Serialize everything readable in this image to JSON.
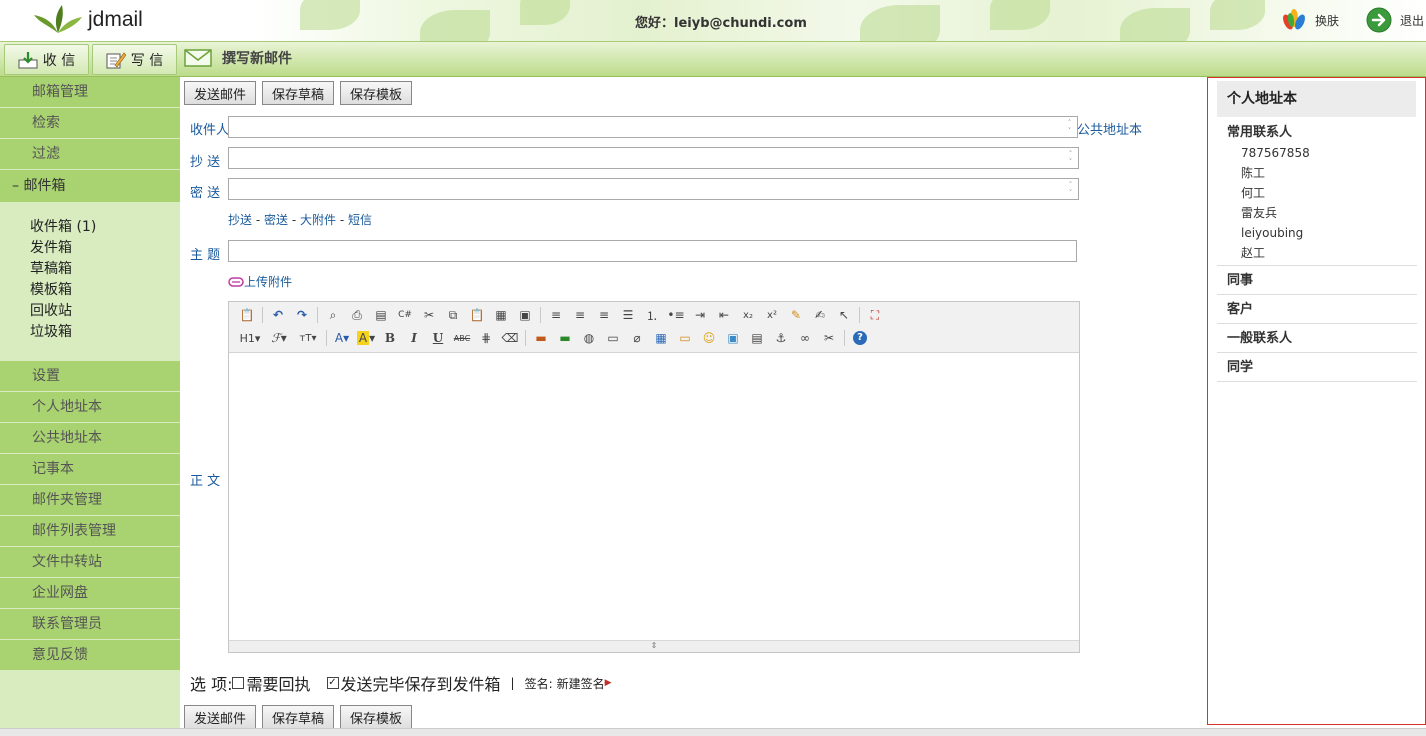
{
  "header": {
    "logo_text": "jdmail",
    "greeting": "您好：leiyb@chundi.com",
    "skin_label": "换肤",
    "logout_label": "退出"
  },
  "toolbar": {
    "receive_label": "收 信",
    "write_label": "写 信",
    "compose_title": "撰写新邮件"
  },
  "sidebar": {
    "top_items": [
      "邮箱管理",
      "检索",
      "过滤"
    ],
    "mailbox_section": "– 邮件箱",
    "folders": [
      "收件箱 (1)",
      "发件箱",
      "草稿箱",
      "模板箱",
      "回收站",
      "垃圾箱"
    ],
    "bottom_items": [
      "设置",
      "个人地址本",
      "公共地址本",
      "记事本",
      "邮件夹管理",
      "邮件列表管理",
      "文件中转站",
      "企业网盘",
      "联系管理员",
      "意见反馈"
    ]
  },
  "compose": {
    "send_label": "发送邮件",
    "save_draft_label": "保存草稿",
    "save_template_label": "保存模板",
    "to_label": "收件人",
    "to_value": "",
    "public_addr_link": "公共地址本",
    "cc_label": "抄 送",
    "cc_value": "",
    "bcc_label": "密 送",
    "bcc_value": "",
    "extra_links": [
      "抄送",
      "密送",
      "大附件",
      "短信"
    ],
    "subject_label": "主 题",
    "subject_value": "",
    "attach_label": "上传附件",
    "body_label": "正 文",
    "body_value": ""
  },
  "options": {
    "label": "选 项:",
    "receipt_label": "需要回执",
    "receipt_checked": false,
    "save_sent_label": "发送完毕保存到发件箱",
    "save_sent_checked": true,
    "separator": "|",
    "signature_label": "签名:",
    "signature_value": "新建签名"
  },
  "address_book": {
    "title": "个人地址本",
    "groups": [
      {
        "name": "常用联系人",
        "contacts": [
          "787567858",
          "陈工",
          "何工",
          "雷友兵",
          "leiyoubing",
          "赵工"
        ]
      },
      {
        "name": "同事",
        "contacts": []
      },
      {
        "name": "客户",
        "contacts": []
      },
      {
        "name": "一般联系人",
        "contacts": []
      },
      {
        "name": "同学",
        "contacts": []
      }
    ]
  },
  "colors": {
    "accent_green": "#a9d271",
    "link_blue": "#1a5a9c",
    "address_border": "#d9302a"
  }
}
